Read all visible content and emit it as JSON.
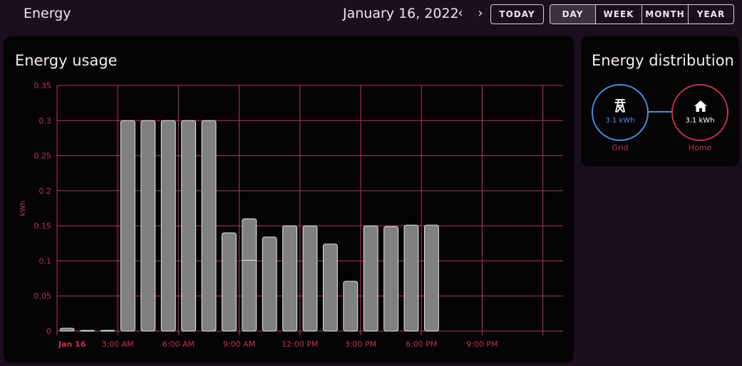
{
  "header": {
    "title": "Energy",
    "date": "January 16, 2022",
    "prev_icon": "chevron-left-icon",
    "next_icon": "chevron-right-icon",
    "today_label": "TODAY",
    "periods": [
      {
        "label": "DAY",
        "active": true
      },
      {
        "label": "WEEK",
        "active": false
      },
      {
        "label": "MONTH",
        "active": false
      },
      {
        "label": "YEAR",
        "active": false
      }
    ]
  },
  "usage_card": {
    "title": "Energy usage"
  },
  "distribution_card": {
    "title": "Energy distribution",
    "grid": {
      "value": "3.1 kWh",
      "label": "Grid",
      "icon": "transmission-tower-icon",
      "color": "#4a8fd8"
    },
    "home": {
      "value": "3.1 kWh",
      "label": "Home",
      "icon": "home-icon",
      "color": "#c0354f"
    },
    "link_color": "#4a8fd8"
  },
  "colors": {
    "accent": "#c0354f",
    "grid_line": "#b23a55",
    "bar_fill": "#808080",
    "bar_stroke": "#e6e6e6"
  },
  "chart_data": {
    "type": "bar",
    "ylabel": "kWh",
    "ylim": [
      0,
      0.35
    ],
    "yticks": [
      "0",
      "0.05",
      "0.1",
      "0.15",
      "0.2",
      "0.25",
      "0.3",
      "0.35"
    ],
    "xtick_labels": [
      "Jan 16",
      "3:00 AM",
      "6:00 AM",
      "9:00 AM",
      "12:00 PM",
      "3:00 PM",
      "6:00 PM",
      "9:00 PM"
    ],
    "hours": [
      0,
      1,
      2,
      3,
      4,
      5,
      6,
      7,
      8,
      9,
      10,
      11,
      12,
      13,
      14,
      15,
      16,
      17,
      18,
      19,
      20,
      21,
      22,
      23
    ],
    "values": [
      0.004,
      0.001,
      0.001,
      0.3,
      0.3,
      0.3,
      0.3,
      0.3,
      0.14,
      0.16,
      0.134,
      0.15,
      0.15,
      0.124,
      0.071,
      0.15,
      0.149,
      0.151,
      0.151,
      null,
      null,
      null,
      null,
      null
    ],
    "secondary_marks": [
      {
        "hour": 9,
        "value": 0.101
      }
    ]
  }
}
